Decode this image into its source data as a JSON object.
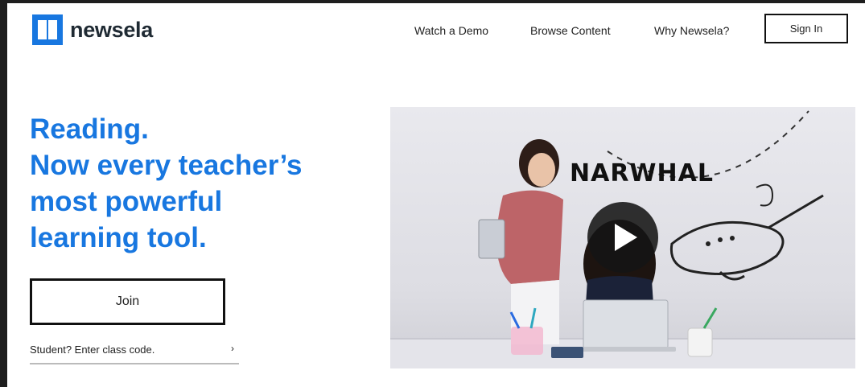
{
  "header": {
    "brand": "newsela",
    "nav": {
      "demo": "Watch a Demo",
      "browse": "Browse Content",
      "why": "Why Newsela?"
    },
    "sign_in": "Sign In"
  },
  "hero": {
    "headline_lines": [
      "Reading.",
      "Now every teacher’s",
      "most powerful",
      "learning tool."
    ],
    "join_label": "Join",
    "student_link": "Student? Enter class code.",
    "student_chevron": "›"
  },
  "video": {
    "whiteboard_word": "NARWHAL",
    "play_icon": "play-icon"
  },
  "colors": {
    "brand_blue": "#1877e0",
    "text_dark": "#1f2a33",
    "border": "#111111"
  }
}
